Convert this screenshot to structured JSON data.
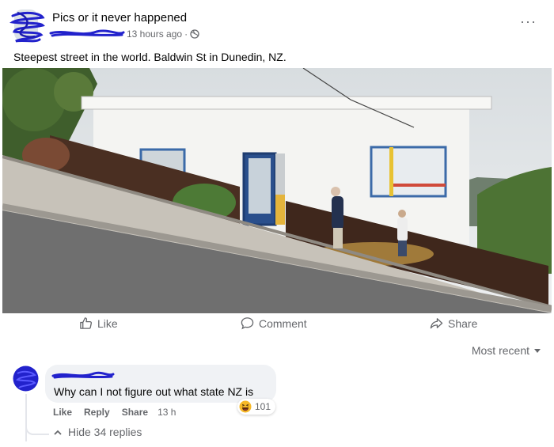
{
  "post": {
    "group_name": "Pics or it never happened",
    "time": "13 hours ago",
    "privacy_icon": "globe-icon",
    "menu_label": "···",
    "text": "Steepest street in the world. Baldwin St in Dunedin, NZ."
  },
  "actions": {
    "like": "Like",
    "comment": "Comment",
    "share": "Share"
  },
  "comments_sort": "Most recent",
  "comment": {
    "text": "Why can I not figure out what state NZ is",
    "reaction_icon": "haha-emoji-icon",
    "reaction_count": "101",
    "like": "Like",
    "reply": "Reply",
    "share": "Share",
    "time": "13 h",
    "replies_toggle": "Hide 34 replies"
  },
  "colors": {
    "scribble": "#2222cc",
    "secondary_text": "#65676b",
    "bubble": "#f0f2f5"
  }
}
